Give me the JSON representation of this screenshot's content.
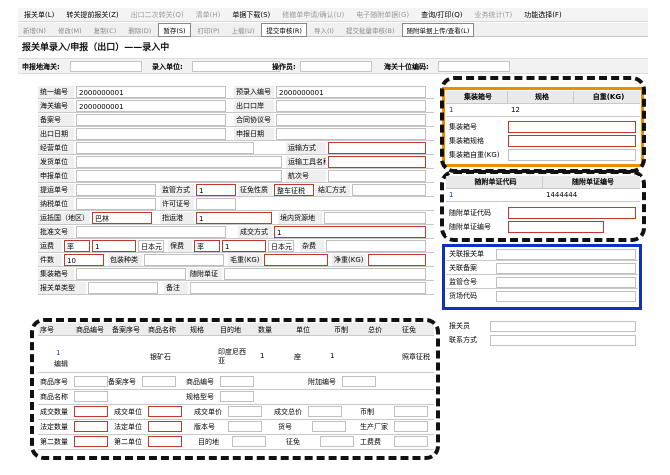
{
  "menu": [
    {
      "label": "报关单(L)",
      "enabled": true
    },
    {
      "label": "转关提前报关(Z)",
      "enabled": true
    },
    {
      "label": "出口二次转关(Q)",
      "enabled": false
    },
    {
      "label": "清单(H)",
      "enabled": false
    },
    {
      "label": "单据下载(S)",
      "enabled": true
    },
    {
      "label": "修撤单申请/确认(U)",
      "enabled": false
    },
    {
      "label": "电子随附单据(G)",
      "enabled": false
    },
    {
      "label": "查询/打印(Q)",
      "enabled": true
    },
    {
      "label": "业务统计(T)",
      "enabled": false
    },
    {
      "label": "功能选择(F)",
      "enabled": true
    }
  ],
  "toolbar": [
    {
      "label": "新增(N)",
      "on": false
    },
    {
      "label": "修改(M)",
      "on": false
    },
    {
      "label": "复制(C)",
      "on": false
    },
    {
      "label": "删除(D)",
      "on": false
    },
    {
      "label": "暂存(S)",
      "on": true
    },
    {
      "label": "打印(P)",
      "on": false
    },
    {
      "label": "上载(U)",
      "on": false
    },
    {
      "label": "提交审核(R)",
      "on": true
    },
    {
      "label": "导入(I)",
      "on": false
    },
    {
      "label": "提交批量审核(B)",
      "on": false
    },
    {
      "label": "随附单据上传/查看(L)",
      "on": true
    }
  ],
  "title": "报关单录入/申报（出口）——录入中",
  "header_strip": {
    "declare_place": "申报地海关:",
    "entry_unit": "录入单位:",
    "operator": "操作员:",
    "customs_code": "海关十位编码:"
  },
  "form": {
    "unified_no_label": "统一编号",
    "unified_no": "2000000001",
    "pre_entry_label": "预录入编号",
    "pre_entry": "2000000001",
    "customs_no_label": "海关编号",
    "customs_no": "2000000001",
    "port_label": "出口口岸",
    "record_label": "备案号",
    "contract_label": "合同协议号",
    "export_date_label": "出口日期",
    "declare_date_label": "申报日期",
    "operator_unit_label": "经营单位",
    "transport_label": "运输方式",
    "sender_label": "发货单位",
    "vehicle_label": "运输工具名称",
    "declarant_label": "申报单位",
    "voyage_label": "航次号",
    "bill_label": "提运单号",
    "supervision_label": "监管方式",
    "supervision": "1",
    "tax_label": "征免性质",
    "tax": "整车征税",
    "settlement_label": "结汇方式",
    "taxpayer_label": "纳税单位",
    "license_label": "许可证号",
    "country_label": "运抵国（地区）",
    "country": "巴林",
    "port_dest_label": "指运港",
    "port_dest": "1",
    "source_label": "境内货源地",
    "approval_label": "批准文号",
    "deal_label": "成交方式",
    "deal": "1",
    "freight_label": "运费",
    "freight_type": "率",
    "freight_val": "1",
    "freight_cur": "日本元",
    "insure_label": "保费",
    "insure_type": "率",
    "insure_val": "1",
    "insure_cur": "日本元",
    "misc_label": "杂费",
    "pieces_label": "件数",
    "pieces": "10",
    "package_label": "包装种类",
    "gross_label": "毛重(KG)",
    "net_label": "净重(KG)",
    "container_label": "集装箱号",
    "attach_label": "随附单证",
    "doc_type_label": "报关单类型",
    "remark_label": "备注"
  },
  "goods_table": {
    "headers": [
      "序号",
      "商品编号",
      "备案序号",
      "商品名称",
      "规格",
      "目的地",
      "数量",
      "单位",
      "币制",
      "总价",
      "征免"
    ],
    "row": {
      "no": "1",
      "sub": "编辑",
      "name": "银矿石",
      "dest": "印度尼西亚",
      "qty": "1",
      "unit": "座",
      "currency": "1",
      "tax": "照章征税"
    },
    "details": [
      [
        "商品序号",
        "备案序号",
        "商品编号",
        "附加编号"
      ],
      [
        "商品名称",
        "规格型号"
      ],
      [
        "成交数量",
        "成交单位",
        "成交单价",
        "成交总价",
        "币制"
      ],
      [
        "法定数量",
        "法定单位",
        "版本号",
        "货号",
        "生产厂家"
      ],
      [
        "第二数量",
        "第二单位",
        "目的地",
        "征免",
        "工费费"
      ]
    ]
  },
  "container_panel": {
    "headers": [
      "集装箱号",
      "规格",
      "自重(KG)"
    ],
    "row": [
      "1",
      "12",
      ""
    ],
    "fields": [
      "集装箱号",
      "集装箱规格",
      "集装箱自重(KG)"
    ]
  },
  "attach_panel": {
    "headers": [
      "随附单证代码",
      "随附单证编号"
    ],
    "row": [
      "1",
      "1444444"
    ],
    "fields": [
      "随附单证代码",
      "随附单证编号"
    ]
  },
  "related_panel": {
    "fields": [
      "关联报关单",
      "关联备案",
      "监管仓号",
      "货场代码"
    ]
  },
  "declarer_panel": {
    "fields": [
      "报关员",
      "联系方式"
    ]
  }
}
